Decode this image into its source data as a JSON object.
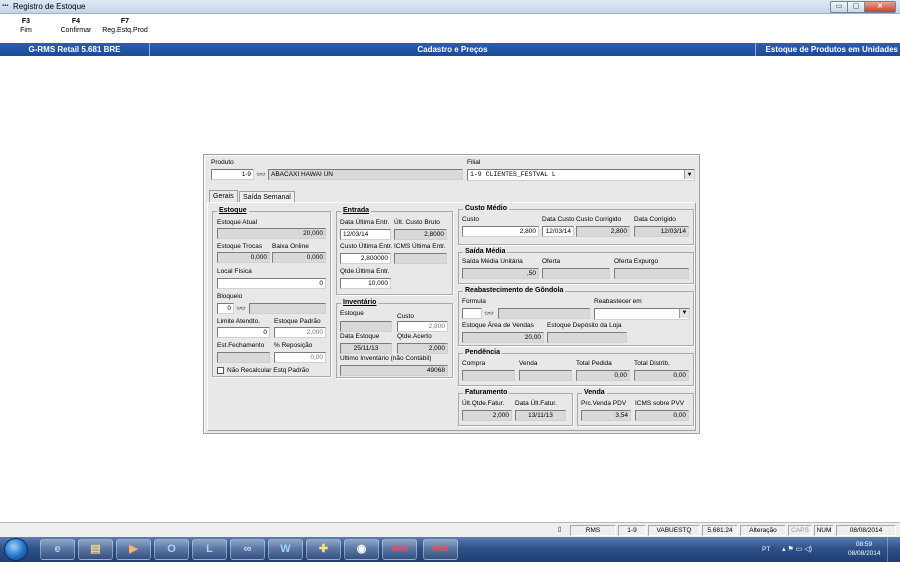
{
  "window": {
    "title": "Registro de Estoque",
    "minimize": "▭",
    "maximize": "▢",
    "close": "✕"
  },
  "fkeys": [
    {
      "key": "F3",
      "label": "Fim"
    },
    {
      "key": "F4",
      "label": "Confirmar"
    },
    {
      "key": "F7",
      "label": "Reg.Estq.Prod"
    }
  ],
  "infobar": {
    "left": "G-RMS Retail 5.681 BRE",
    "center": "Cadastro e Preços",
    "right": "Estoque de Produtos em Unidades"
  },
  "produto": {
    "label": "Produto",
    "code": "1-9",
    "name": "ABACAXI HAWAI UN"
  },
  "filial": {
    "label": "Filial",
    "value": "1-9      CLIENTES_FESTVAL L"
  },
  "tabs": [
    "Gerais",
    "Saída Semanal"
  ],
  "estoque": {
    "title": "Estoque",
    "atual_label": "Estoque Atual",
    "atual": "20,000",
    "trocas_label": "Estoque Trocas",
    "trocas": "0,000",
    "baixa_label": "Baixa Online",
    "baixa": "0,000",
    "local_label": "Local Física",
    "local": "0",
    "bloqueio_label": "Bloqueio",
    "bloqueio": "0",
    "limite_label": "Limite Atendto.",
    "limite": "0",
    "padrao_label": "Estoque Padrão",
    "padrao": "2,000",
    "fechamento_label": "Est.Fechamento",
    "reposicao_label": "% Reposição",
    "reposicao": "0,00",
    "nao_recalcular": "Não Recalcular Estq Padrão"
  },
  "entrada": {
    "title": "Entrada",
    "data_label": "Data Última Entr.",
    "data": "12/03/14",
    "custo_bruto_label": "Últ. Custo Bruto",
    "custo_bruto": "2,8000",
    "custo_ult_label": "Custo Última Entr.",
    "custo_ult": "2,800000",
    "icms_label": "ICMS Última Entr.",
    "qtde_label": "Qtde.Última Entr.",
    "qtde": "10,000"
  },
  "inventario": {
    "title": "Inventário",
    "estoque_label": "Estoque",
    "custo_label": "Custo",
    "custo": "2,800",
    "data_label": "Data Estoque",
    "data": "25/11/13",
    "acerto_label": "Qtde.Acerto",
    "acerto": "2,000",
    "ultimo_label": "Ultimo Inventário (não Contábil)",
    "ultimo": "49068"
  },
  "custo_medio": {
    "title": "Custo Médio",
    "custo_label": "Custo",
    "custo": "2,800",
    "data_label": "Data Custo",
    "data": "12/03/14",
    "corrigido_label": "Custo Corrigido",
    "corrigido": "2,800",
    "data_corr_label": "Data Corrigido",
    "data_corr": "12/03/14"
  },
  "saida_media": {
    "title": "Saída Média",
    "unitaria_label": "Saída Média Unitária",
    "unitaria": ",50",
    "oferta_label": "Oferta",
    "expurgo_label": "Oferta Expurgo"
  },
  "reabastecimento": {
    "title": "Reabastecimento de Gôndola",
    "formula_label": "Formula",
    "reabastecer_label": "Reabastecer em",
    "area_label": "Estoque Área de Vendas",
    "area": "20,00",
    "deposito_label": "Estoque Depósito da Loja"
  },
  "pendencia": {
    "title": "Pendência",
    "compra_label": "Compra",
    "venda_label": "Venda",
    "total_pedida_label": "Total Pedida",
    "total_pedida": "0,00",
    "total_distrib_label": "Total  Distrib.",
    "total_distrib": "0,00"
  },
  "faturamento": {
    "title": "Faturamento",
    "qtde_label": "Últ.Qtde.Fatur.",
    "qtde": "2,000",
    "data_label": "Data Últ.Fatur.",
    "data": "13/11/13"
  },
  "venda": {
    "title": "Venda",
    "prc_label": "Prc.Venda PDV",
    "prc": "3,54",
    "icms_label": "ICMS sobre PVV",
    "icms": "0,00"
  },
  "statusbar": [
    "RMS",
    "1-9",
    "VABUESTQ",
    "5.681.24",
    "Alteração",
    "CAPS",
    "NUM",
    "08/08/2014"
  ],
  "taskbar": {
    "lang": "PT",
    "time": "08:59",
    "date": "08/08/2014",
    "rms1": "RMS",
    "rms2": "RMS"
  }
}
